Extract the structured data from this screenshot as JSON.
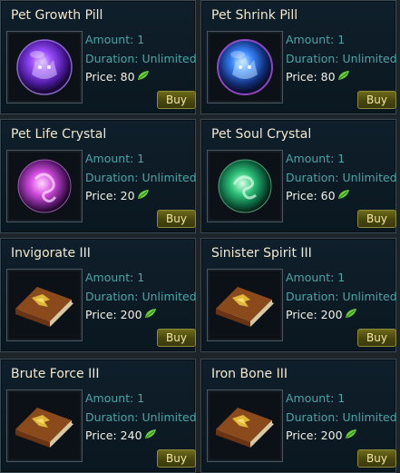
{
  "labels": {
    "amount_prefix": "Amount: ",
    "duration_prefix": "Duration: ",
    "price_prefix": "Price: ",
    "buy": "Buy"
  },
  "currency_icon": "green-leaf-icon",
  "items": [
    {
      "name": "Pet Growth Pill",
      "amount": "Amount: 1",
      "duration": "Duration: Unlimited",
      "price": "Price: 80",
      "icon": "purple-wolf-orb-icon",
      "buy": "Buy"
    },
    {
      "name": "Pet Shrink Pill",
      "amount": "Amount: 1",
      "duration": "Duration: Unlimited",
      "price": "Price: 80",
      "icon": "blue-wolf-orb-icon",
      "buy": "Buy"
    },
    {
      "name": "Pet Life Crystal",
      "amount": "Amount: 1",
      "duration": "Duration: Unlimited",
      "price": "Price: 20",
      "icon": "pink-crystal-orb-icon",
      "buy": "Buy"
    },
    {
      "name": "Pet Soul Crystal",
      "amount": "Amount: 1",
      "duration": "Duration: Unlimited",
      "price": "Price: 60",
      "icon": "green-crystal-orb-icon",
      "buy": "Buy"
    },
    {
      "name": "Invigorate III",
      "amount": "Amount: 1",
      "duration": "Duration: Unlimited",
      "price": "Price: 200",
      "icon": "skill-book-icon",
      "buy": "Buy"
    },
    {
      "name": "Sinister Spirit III",
      "amount": "Amount: 1",
      "duration": "Duration: Unlimited",
      "price": "Price: 200",
      "icon": "skill-book-icon",
      "buy": "Buy"
    },
    {
      "name": "Brute Force III",
      "amount": "Amount: 1",
      "duration": "Duration: Unlimited",
      "price": "Price: 240",
      "icon": "skill-book-icon",
      "buy": "Buy"
    },
    {
      "name": "Iron Bone III",
      "amount": "Amount: 1",
      "duration": "Duration: Unlimited",
      "price": "Price: 200",
      "icon": "skill-book-icon",
      "buy": "Buy"
    }
  ],
  "colors": {
    "title": "#f2e8cf",
    "info": "#4aa6a6",
    "price": "#f4f1e6",
    "button": "#5a5815",
    "leaf": "#6ad03a"
  }
}
